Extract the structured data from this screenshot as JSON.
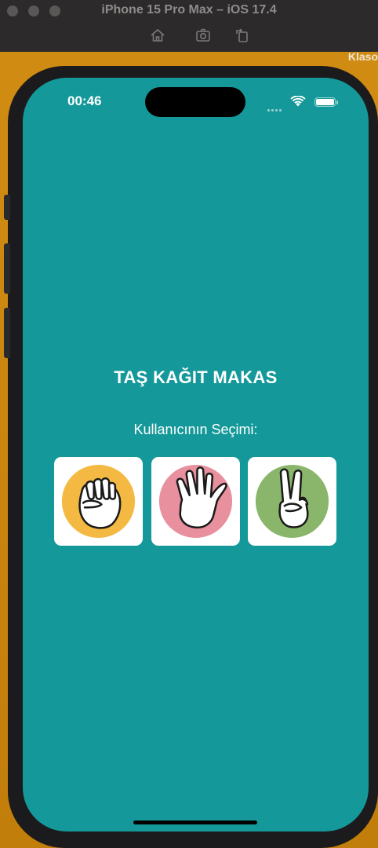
{
  "simulator": {
    "title": "iPhone 15 Pro Max – iOS 17.4",
    "toolbar": [
      "home-icon",
      "screenshot-icon",
      "rotate-icon"
    ],
    "desktop_label": "Klaso"
  },
  "status_bar": {
    "time": "00:46"
  },
  "app": {
    "title": "TAŞ KAĞIT MAKAS",
    "choice_label": "Kullanıcının Seçimi:",
    "choices": [
      {
        "name": "rock",
        "icon": "fist-icon",
        "color": "#f4b942"
      },
      {
        "name": "paper",
        "icon": "open-hand-icon",
        "color": "#e8909e"
      },
      {
        "name": "scissors",
        "icon": "peace-sign-icon",
        "color": "#8ab66b"
      }
    ]
  },
  "colors": {
    "background": "#149899",
    "card": "#ffffff",
    "text": "#ffffff"
  }
}
